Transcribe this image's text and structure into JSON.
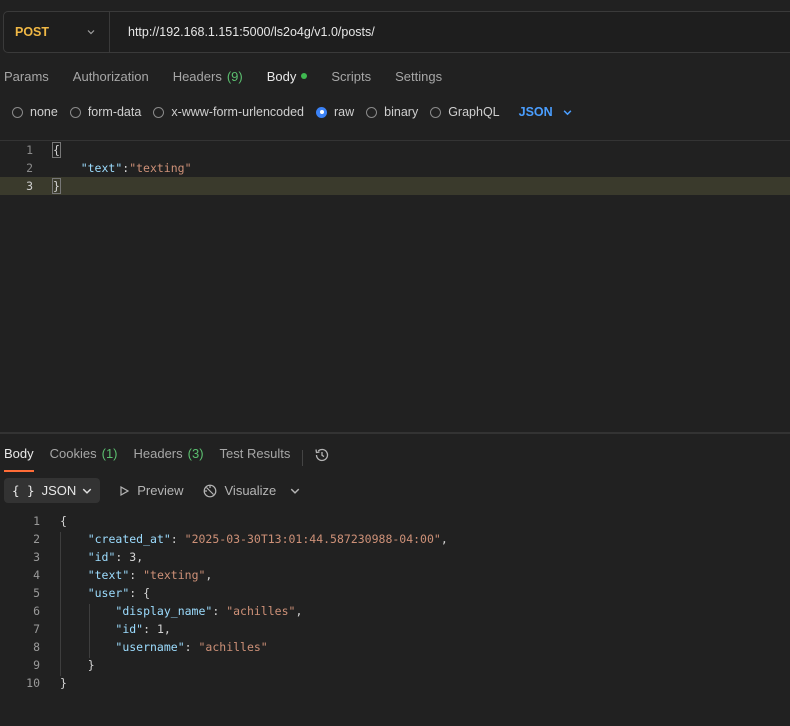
{
  "request": {
    "method": "POST",
    "url": "http://192.168.1.151:5000/ls2o4g/v1.0/posts/"
  },
  "request_tabs": [
    {
      "label": "Params"
    },
    {
      "label": "Authorization"
    },
    {
      "label": "Headers",
      "count": "(9)"
    },
    {
      "label": "Body"
    },
    {
      "label": "Scripts"
    },
    {
      "label": "Settings"
    }
  ],
  "body_types": {
    "options": [
      "none",
      "form-data",
      "x-www-form-urlencoded",
      "raw",
      "binary",
      "GraphQL"
    ],
    "selected": "raw",
    "language": "JSON"
  },
  "request_body": {
    "line_numbers": [
      "1",
      "2",
      "3"
    ],
    "open": "{",
    "key": "\"text\"",
    "colon": ":",
    "value": "\"texting\"",
    "close": "}"
  },
  "response_tabs": [
    {
      "label": "Body"
    },
    {
      "label": "Cookies",
      "count": "(1)"
    },
    {
      "label": "Headers",
      "count": "(3)"
    },
    {
      "label": "Test Results"
    }
  ],
  "response_toolbar": {
    "format_braces": "{ }",
    "format": "JSON",
    "preview": "Preview",
    "visualize": "Visualize"
  },
  "response_body": {
    "line_numbers": [
      "1",
      "2",
      "3",
      "4",
      "5",
      "6",
      "7",
      "8",
      "9",
      "10"
    ],
    "l1": "{",
    "l2_key": "\"created_at\"",
    "l2_val": "\"2025-03-30T13:01:44.587230988-04:00\"",
    "l3_key": "\"id\"",
    "l3_val": "3",
    "l4_key": "\"text\"",
    "l4_val": "\"texting\"",
    "l5_key": "\"user\"",
    "l5_open": "{",
    "l6_key": "\"display_name\"",
    "l6_val": "\"achilles\"",
    "l7_key": "\"id\"",
    "l7_val": "1",
    "l8_key": "\"username\"",
    "l8_val": "\"achilles\"",
    "l9": "}",
    "l10": "}",
    "colon": ": ",
    "comma": ","
  },
  "colors": {
    "method": "#f0b845",
    "accent": "#ff6c37",
    "link": "#4a9eff",
    "count": "#5bbf6f",
    "key": "#9cdcfe",
    "string": "#ce9178"
  }
}
